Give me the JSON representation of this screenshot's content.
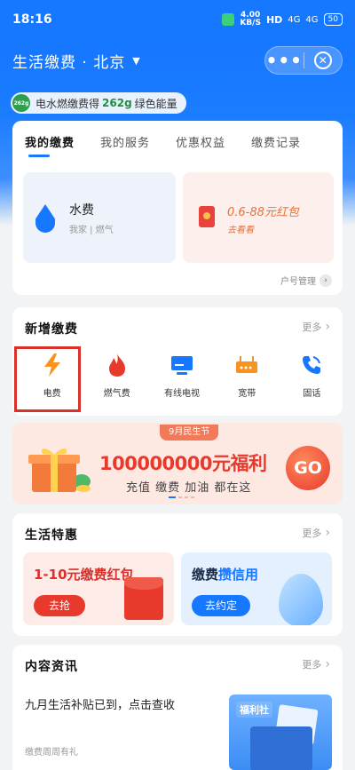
{
  "status_bar": {
    "time": "18:16",
    "net_speed": "4.00",
    "net_unit": "KB/S",
    "hd": "HD",
    "signal_1": "4G",
    "signal_2": "4G",
    "battery": "50"
  },
  "nav": {
    "title": "生活缴费 · 北京",
    "caret": "▼",
    "more": "•••",
    "close": "✕"
  },
  "energy": {
    "badge": "262g",
    "prefix": "电水燃缴费得",
    "amount": "262g",
    "suffix": "绿色能量"
  },
  "tabs": [
    {
      "label": "我的缴费"
    },
    {
      "label": "我的服务"
    },
    {
      "label": "优惠权益"
    },
    {
      "label": "缴费记录"
    }
  ],
  "my_payments": {
    "water": {
      "title": "水费",
      "sub": "我家 | 燃气"
    },
    "hongbao": {
      "title": "0.6-88元红包",
      "sub": "去看看"
    },
    "account_link": "户号管理",
    "account_arrow": "›"
  },
  "add_payment": {
    "title": "新增缴费",
    "more": "更多",
    "chevron": "›",
    "items": [
      {
        "label": "电费",
        "icon": "lightning-icon"
      },
      {
        "label": "燃气费",
        "icon": "flame-icon"
      },
      {
        "label": "有线电视",
        "icon": "tv-icon"
      },
      {
        "label": "宽带",
        "icon": "router-icon"
      },
      {
        "label": "固话",
        "icon": "phone-icon"
      }
    ]
  },
  "promo": {
    "tag": "9月民生节",
    "headline": "100000000元福利",
    "sub": "充值 缴费 加油 都在这",
    "go": "GO"
  },
  "deals": {
    "title": "生活特惠",
    "more": "更多",
    "chevron": "›",
    "left": {
      "title": "1-10元缴费红包",
      "button": "去抢"
    },
    "right": {
      "title_prefix": "缴费",
      "title_highlight": "攒信用",
      "button": "去约定"
    }
  },
  "news": {
    "title": "内容资讯",
    "more": "更多",
    "chevron": "›",
    "headline": "九月生活补贴已到，点击查收",
    "source": "缴费周周有礼",
    "thumb_tag": "福利社"
  },
  "colors": {
    "brand_blue": "#1677ff",
    "accent_red": "#e8392d",
    "energy_green": "#1f8f3f",
    "highlight_box": "#d9302a"
  }
}
